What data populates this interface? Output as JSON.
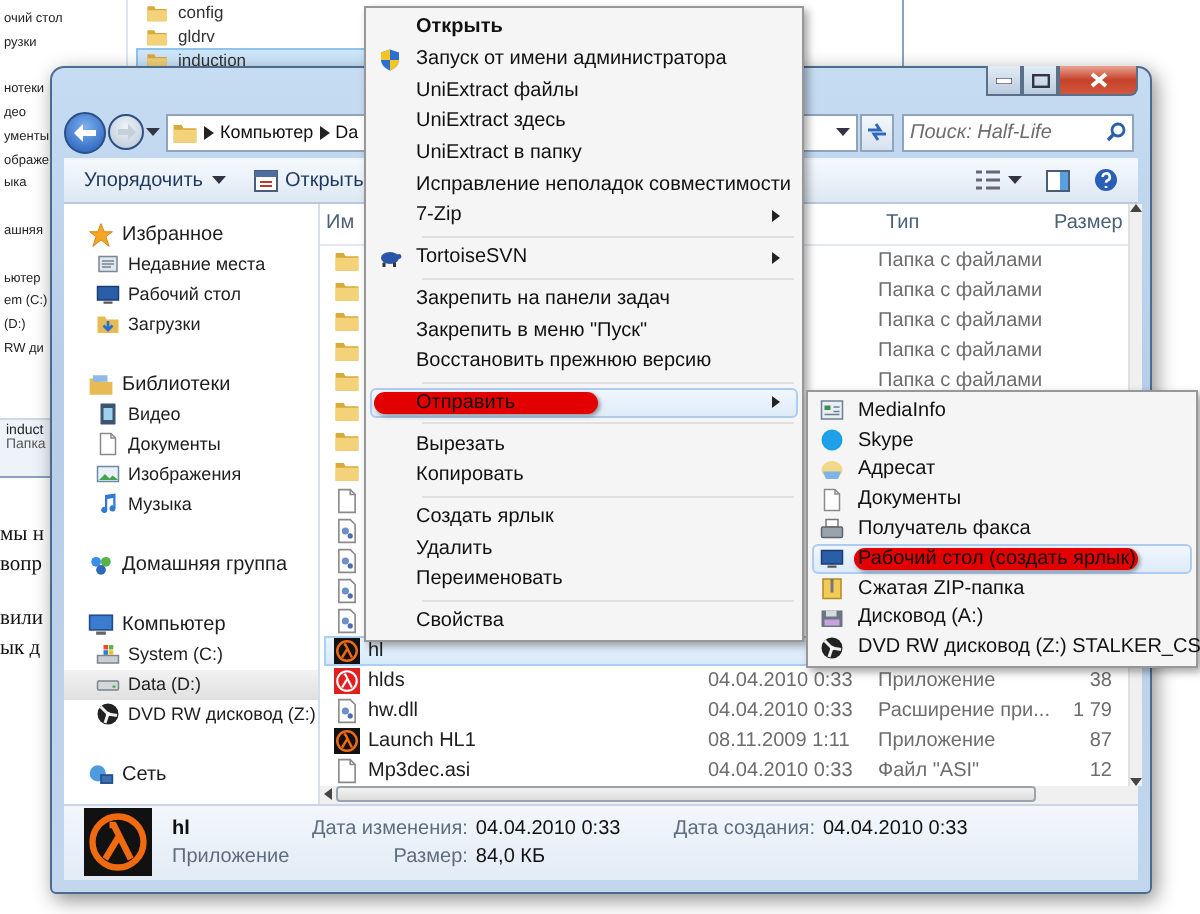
{
  "back_window": {
    "nav_groups": [
      [
        "очий стол",
        "рузки"
      ],
      [
        "нотеки",
        "део",
        "ументы",
        "ображе",
        "ыка"
      ],
      [
        "ашняя"
      ],
      [
        "ьютер",
        "em (C:)",
        "(D:)",
        "RW ди"
      ]
    ],
    "files": [
      {
        "name": "config",
        "selected": false
      },
      {
        "name": "gldrv",
        "selected": false
      },
      {
        "name": "induction",
        "selected": true
      }
    ],
    "details": {
      "name": "induct",
      "type": "Папка"
    }
  },
  "background_text": [
    [
      "мы н",
      "вопр"
    ],
    [
      "вили",
      "ык д"
    ]
  ],
  "window": {
    "address": [
      "Компьютер",
      "Da"
    ],
    "search": {
      "placeholder": "Поиск: Half-Life"
    },
    "toolbar": [
      {
        "label": "Упорядочить",
        "kind": "menu"
      },
      {
        "label": "Открыть",
        "kind": "action"
      }
    ],
    "nav_groups": [
      [
        {
          "label": "Избранное",
          "kind": "star",
          "selected": false
        },
        {
          "label": "Недавние места",
          "kind": "recent",
          "selected": false
        },
        {
          "label": "Рабочий стол",
          "kind": "desktop",
          "selected": false
        },
        {
          "label": "Загрузки",
          "kind": "downloads",
          "selected": false
        }
      ],
      [
        {
          "label": "Библиотеки",
          "kind": "libraries",
          "selected": false
        },
        {
          "label": "Видео",
          "kind": "video",
          "selected": false
        },
        {
          "label": "Документы",
          "kind": "documents",
          "selected": false
        },
        {
          "label": "Изображения",
          "kind": "pictures",
          "selected": false
        },
        {
          "label": "Музыка",
          "kind": "music",
          "selected": false
        }
      ],
      [
        {
          "label": "Домашняя группа",
          "kind": "homegroup",
          "selected": false
        }
      ],
      [
        {
          "label": "Компьютер",
          "kind": "computer",
          "selected": false
        },
        {
          "label": "System (C:)",
          "kind": "drive-c",
          "selected": false
        },
        {
          "label": "Data (D:)",
          "kind": "drive",
          "selected": true
        },
        {
          "label": "DVD RW дисковод (Z:)",
          "kind": "dvd",
          "selected": false
        }
      ],
      [
        {
          "label": "Сеть",
          "kind": "network",
          "selected": false
        }
      ]
    ],
    "columns": [
      "Им",
      "Тип",
      "Размер"
    ],
    "rows": [
      {
        "kind": "folder",
        "selected": false,
        "type": "Папка с файлами"
      },
      {
        "kind": "folder",
        "selected": false,
        "type": "Папка с файлами"
      },
      {
        "kind": "folder",
        "selected": false,
        "type": "Папка с файлами"
      },
      {
        "kind": "folder",
        "selected": false,
        "type": "Папка с файлами"
      },
      {
        "kind": "folder",
        "selected": false,
        "type": "Папка с файлами"
      },
      {
        "kind": "folder",
        "selected": false
      },
      {
        "kind": "folder",
        "selected": false
      },
      {
        "kind": "folder",
        "selected": false
      },
      {
        "kind": "doc",
        "selected": false
      },
      {
        "kind": "dll",
        "selected": false
      },
      {
        "kind": "dll",
        "selected": false
      },
      {
        "kind": "dll",
        "selected": false
      },
      {
        "kind": "dll",
        "selected": false
      },
      {
        "kind": "hl",
        "selected": true,
        "name": "hl"
      },
      {
        "kind": "hlred",
        "selected": false,
        "name": "hlds",
        "date": "04.04.2010 0:33",
        "type": "Приложение",
        "size": "38"
      },
      {
        "kind": "dll",
        "selected": false,
        "name": "hw.dll",
        "date": "04.04.2010 0:33",
        "type": "Расширение при...",
        "size": "1 79"
      },
      {
        "kind": "hl",
        "selected": false,
        "name": "Launch HL1",
        "date": "08.11.2009 1:11",
        "type": "Приложение",
        "size": "87"
      },
      {
        "kind": "doc",
        "selected": false,
        "name": "Mp3dec.asi",
        "date": "04.04.2010 0:33",
        "type": "Файл \"ASI\"",
        "size": "12"
      }
    ],
    "details": {
      "name": "hl",
      "type": "Приложение",
      "fields": [
        {
          "label": "Дата изменения:",
          "value": "04.04.2010 0:33"
        },
        {
          "label": "Размер:",
          "value": "84,0 КБ"
        },
        {
          "label": "Дата создания:",
          "value": "04.04.2010 0:33"
        }
      ]
    }
  },
  "context_menu": [
    [
      {
        "label": "Открыть",
        "default": true,
        "submenu": false,
        "selected": false,
        "marked": false
      },
      {
        "label": "Запуск от имени администратора",
        "kind": "shield",
        "default": false,
        "submenu": false,
        "selected": false,
        "marked": false
      },
      {
        "label": "UniExtract файлы",
        "default": false,
        "submenu": false,
        "selected": false,
        "marked": false
      },
      {
        "label": "UniExtract здесь",
        "default": false,
        "submenu": false,
        "selected": false,
        "marked": false
      },
      {
        "label": "UniExtract в папку",
        "default": false,
        "submenu": false,
        "selected": false,
        "marked": false
      },
      {
        "label": "Исправление неполадок совместимости",
        "default": false,
        "submenu": false,
        "selected": false,
        "marked": false
      },
      {
        "label": "7-Zip",
        "default": false,
        "submenu": true,
        "selected": false,
        "marked": false
      }
    ],
    [
      {
        "label": "TortoiseSVN",
        "kind": "tortoise",
        "default": false,
        "submenu": true,
        "selected": false,
        "marked": false
      }
    ],
    [
      {
        "label": "Закрепить на панели задач",
        "default": false,
        "submenu": false,
        "selected": false,
        "marked": false
      },
      {
        "label": "Закрепить в меню \"Пуск\"",
        "default": false,
        "submenu": false,
        "selected": false,
        "marked": false
      },
      {
        "label": "Восстановить прежнюю версию",
        "default": false,
        "submenu": false,
        "selected": false,
        "marked": false
      }
    ],
    [
      {
        "label": "Отправить",
        "default": false,
        "submenu": true,
        "selected": true,
        "marked": true
      }
    ],
    [
      {
        "label": "Вырезать",
        "default": false,
        "submenu": false,
        "selected": false,
        "marked": false
      },
      {
        "label": "Копировать",
        "default": false,
        "submenu": false,
        "selected": false,
        "marked": false
      }
    ],
    [
      {
        "label": "Создать ярлык",
        "default": false,
        "submenu": false,
        "selected": false,
        "marked": false
      },
      {
        "label": "Удалить",
        "default": false,
        "submenu": false,
        "selected": false,
        "marked": false
      },
      {
        "label": "Переименовать",
        "default": false,
        "submenu": false,
        "selected": false,
        "marked": false
      }
    ],
    [
      {
        "label": "Свойства",
        "default": false,
        "submenu": false,
        "selected": false,
        "marked": false
      }
    ]
  ],
  "send_to_menu": [
    {
      "label": "MediaInfo",
      "kind": "mediainfo",
      "selected": false,
      "marked": false
    },
    {
      "label": "Skype",
      "kind": "skype",
      "selected": false,
      "marked": false
    },
    {
      "label": "Адресат",
      "kind": "mail",
      "selected": false,
      "marked": false
    },
    {
      "label": "Документы",
      "kind": "documents",
      "selected": false,
      "marked": false
    },
    {
      "label": "Получатель факса",
      "kind": "fax",
      "selected": false,
      "marked": false
    },
    {
      "label": "Рабочий стол (создать ярлык)",
      "kind": "desktop",
      "selected": true,
      "marked": true
    },
    {
      "label": "Сжатая ZIP-папка",
      "kind": "zip",
      "selected": false,
      "marked": false
    },
    {
      "label": "Дисковод (A:)",
      "kind": "floppy",
      "selected": false,
      "marked": false
    },
    {
      "label": "DVD RW дисковод (Z:) STALKER_CS",
      "kind": "dvd",
      "selected": false,
      "marked": false
    }
  ]
}
